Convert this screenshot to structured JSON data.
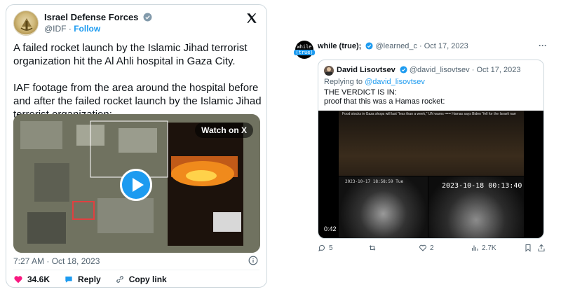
{
  "left_tweet": {
    "account_name": "Israel Defense Forces",
    "handle": "@IDF",
    "separator": "·",
    "follow_label": "Follow",
    "paragraph_1": "A failed rocket launch by the Islamic Jihad terrorist organization hit the Al Ahli hospital in Gaza City.",
    "paragraph_2": "IAF footage from the area around the hospital before and after the failed rocket launch by the Islamic Jihad terrorist organization:",
    "watch_label": "Watch on X",
    "timestamp": "7:27 AM · Oct 18, 2023",
    "like_count": "34.6K",
    "reply_label": "Reply",
    "copy_label": "Copy link",
    "brand_color": "#1d9bf0",
    "like_color": "#f91880"
  },
  "right_tweet": {
    "avatar_line1": "while",
    "avatar_line2": "(true)",
    "account_name": "while (true);",
    "handle": "@learned_c",
    "date": "Oct 17, 2023",
    "separator": "·",
    "more_label": "···",
    "quoted": {
      "account_name": "David Lisovtsev",
      "handle": "@david_lisovtsev",
      "date": "Oct 17, 2023",
      "replying_prefix": "Replying to",
      "replying_handle": "@david_lisovtsev",
      "line_1": "THE VERDICT IS IN:",
      "line_2": "proof that this was a Hamas rocket:",
      "ticker": "Food stocks in Gaza shops will last \"less than a week,\" UN warns ••••• Hamas says Biden \"fell for the Israeli narr",
      "cam_timestamp_small": "2023-10-17 18:58:59 Tue",
      "cam_timestamp_big": "2023-10-18  00:13:40",
      "duration": "0:42"
    },
    "reply_count": "5",
    "like_count": "2",
    "view_count": "2.7K"
  }
}
